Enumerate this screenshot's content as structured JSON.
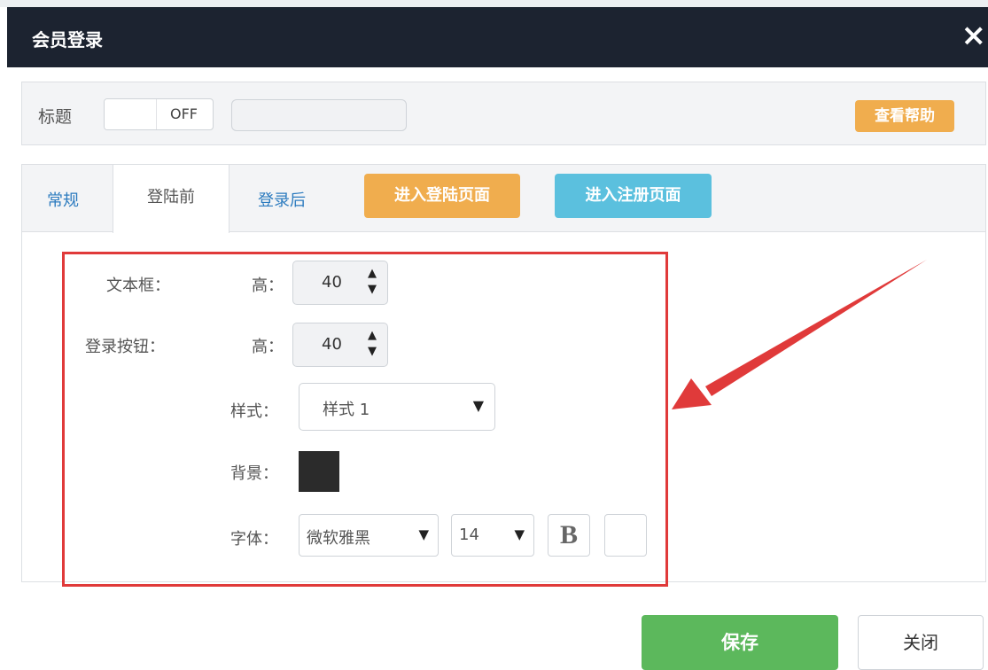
{
  "dialog": {
    "title": "会员登录",
    "close_icon": "×"
  },
  "header": {
    "title_label": "标题",
    "toggle_state": "OFF",
    "title_input_value": "",
    "help_button": "查看帮助"
  },
  "tabs": {
    "items": [
      {
        "label": "常规",
        "active": false
      },
      {
        "label": "登陆前",
        "active": true
      },
      {
        "label": "登录后",
        "active": false
      }
    ],
    "enter_login_button": "进入登陆页面",
    "enter_register_button": "进入注册页面"
  },
  "form": {
    "textbox_label": "文本框：",
    "textbox_height_label": "高：",
    "textbox_height_value": "40",
    "login_button_label": "登录按钮：",
    "button_height_label": "高：",
    "button_height_value": "40",
    "style_label": "样式：",
    "style_value": "样式 1",
    "background_label": "背景：",
    "background_color": "#2b2b2b",
    "font_label": "字体：",
    "font_family_value": "微软雅黑",
    "font_size_value": "14",
    "bold_label": "B"
  },
  "footer": {
    "save_button": "保存",
    "close_button": "关闭"
  },
  "colors": {
    "titlebar": "#1c2330",
    "help_orange": "#f0ad4e",
    "register_blue": "#5bc0de",
    "save_green": "#5cb85c",
    "highlight_red": "#e03a3a",
    "tab_link": "#2c7bbf"
  }
}
